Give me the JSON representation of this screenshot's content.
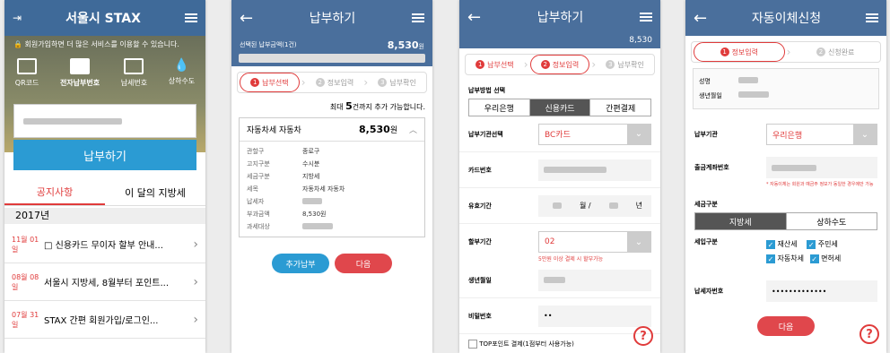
{
  "screen1": {
    "title": "서울시 STAX",
    "notice": "회원가입하면 더 많은 서비스를 이용할 수 있습니다.",
    "icons": [
      {
        "label": "QR코드",
        "icon": "qr-icon"
      },
      {
        "label": "전자납부번호",
        "icon": "card-icon"
      },
      {
        "label": "납세번호",
        "icon": "grid-icon"
      },
      {
        "label": "상하수도",
        "icon": "water-drop-icon"
      }
    ],
    "pay_button": "납부하기",
    "tabs": [
      "공지사항",
      "이 달의 지방세"
    ],
    "year": "2017년",
    "news": [
      {
        "date": "11월 01일",
        "title": "□ 신용카드 무이자 할부 안내..."
      },
      {
        "date": "08월 08일",
        "title": "서울시 지방세, 8월부터 포인트..."
      },
      {
        "date": "07월 31일",
        "title": "STAX 간편 회원가입/로그인..."
      }
    ]
  },
  "screen2": {
    "title": "납부하기",
    "amount_label": "선택된 납부금액(1건)",
    "amount_value": "8,530",
    "amount_unit": "원",
    "steps": [
      "납부선택",
      "정보입력",
      "납부확인"
    ],
    "max_prefix": "최대 ",
    "max_num": "5",
    "max_suffix": "건까지 추가 가능합니다.",
    "card_title": "자동차세 자동차",
    "card_amount": "8,530",
    "card_unit": "원",
    "rows": [
      {
        "k": "관할구",
        "v": "종로구"
      },
      {
        "k": "고지구분",
        "v": "수시분"
      },
      {
        "k": "세금구분",
        "v": "지방세"
      },
      {
        "k": "세목",
        "v": "자동차세 자동차"
      },
      {
        "k": "납세자",
        "v": ""
      },
      {
        "k": "부과금액",
        "v": "8,530원"
      },
      {
        "k": "과세대상",
        "v": ""
      }
    ],
    "add_button": "추가납부",
    "next_button": "다음"
  },
  "screen3": {
    "title": "납부하기",
    "amount_value": "8,530",
    "steps": [
      "납부선택",
      "정보입력",
      "납부확인"
    ],
    "method_label": "납부방법 선택",
    "methods": [
      "우리은행",
      "신용카드",
      "간편결제"
    ],
    "org_label": "납부기관선택",
    "org_value": "BC카드",
    "card_label": "카드번호",
    "expiry_label": "유효기간",
    "expiry_month": "월 /",
    "expiry_year": "년",
    "install_label": "할부기간",
    "install_value": "02",
    "install_hint": "5만원 이상 결제 시 할부가능",
    "birth_label": "생년월일",
    "pw_label": "비밀번호",
    "pw_value": "••",
    "point_label": "TOP포인트 결제(1점부터 사용가능)",
    "help": "?"
  },
  "screen4": {
    "title": "자동이체신청",
    "steps": [
      "정보입력",
      "신청완료"
    ],
    "name_label": "성명",
    "birth_label": "생년월일",
    "org_label": "납부기관",
    "org_value": "우리은행",
    "account_label": "출금계좌번호",
    "account_hint": "* 자동이체는 회원과 예금주 정보가 동일한 경우에만 가능",
    "taxtype_label": "세금구분",
    "taxtypes": [
      "지방세",
      "상하수도"
    ],
    "items_label": "세입구분",
    "items": [
      "재산세",
      "주민세",
      "자동차세",
      "면허세"
    ],
    "taxno_label": "납세자번호",
    "taxno_value": "•••••••••••••",
    "next_button": "다음",
    "help": "?"
  }
}
